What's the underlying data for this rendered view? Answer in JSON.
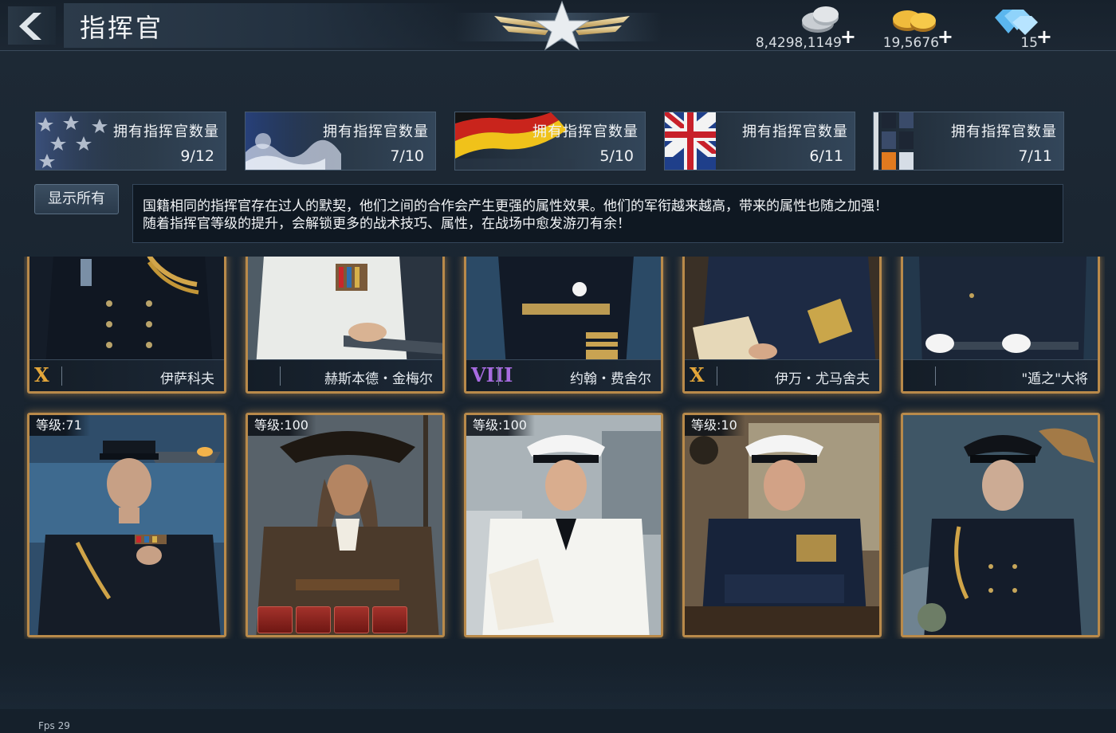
{
  "header": {
    "title": "指挥官",
    "currencies": [
      {
        "icon": "silver-coin-icon",
        "value": "8,4298,1149"
      },
      {
        "icon": "gold-coin-icon",
        "value": "19,5676"
      },
      {
        "icon": "diamond-icon",
        "value": "15"
      }
    ],
    "plus": "+"
  },
  "nations": [
    {
      "flag": "usa",
      "label": "拥有指挥官数量",
      "count": "9/12"
    },
    {
      "flag": "japan",
      "label": "拥有指挥官数量",
      "count": "7/10"
    },
    {
      "flag": "germany",
      "label": "拥有指挥官数量",
      "count": "5/10"
    },
    {
      "flag": "uk",
      "label": "拥有指挥官数量",
      "count": "6/11"
    },
    {
      "flag": "other",
      "label": "拥有指挥官数量",
      "count": "7/11"
    }
  ],
  "filter": {
    "show_all": "显示所有"
  },
  "info": {
    "line1": "国籍相同的指挥官存在过人的默契，他们之间的合作会产生更强的属性效果。他们的军衔越来越高，带来的属性也随之加强！",
    "line2": "随着指挥官等级的提升，会解锁更多的战术技巧、属性，在战场中愈发游刃有余！"
  },
  "commanders_top": [
    {
      "rank": "X",
      "rank_color": "#e3a63a",
      "name": "伊萨科夫"
    },
    {
      "rank": "",
      "rank_color": "#e3a63a",
      "name": "赫斯本德・金梅尔"
    },
    {
      "rank": "VIII",
      "rank_color": "#a76be0",
      "name": "约翰・费舍尔"
    },
    {
      "rank": "X",
      "rank_color": "#e3a63a",
      "name": "伊万・尤马舍夫"
    },
    {
      "rank": "",
      "rank_color": "#e3a63a",
      "name": "\"遁之\"大将"
    }
  ],
  "commanders_bottom": [
    {
      "level": "等级:71"
    },
    {
      "level": "等级:100"
    },
    {
      "level": "等级:100"
    },
    {
      "level": "等级:10"
    },
    {
      "level": ""
    }
  ],
  "status": {
    "fps": "Fps 29"
  }
}
